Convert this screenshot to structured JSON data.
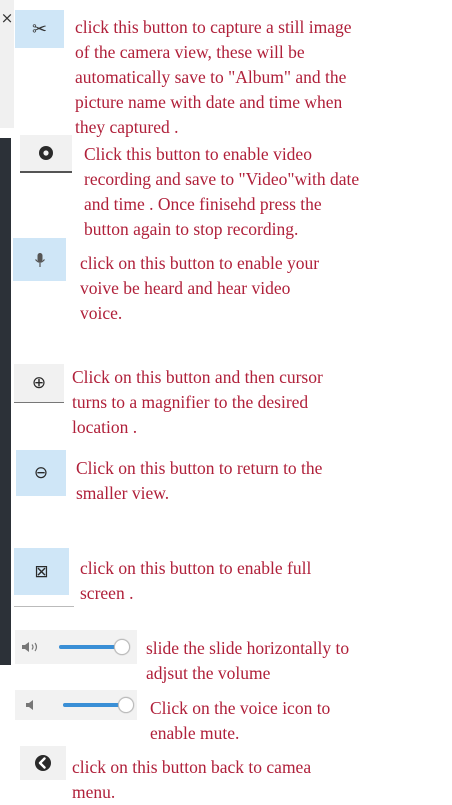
{
  "close_glyph": "×",
  "items": [
    {
      "icon": "scissors-icon",
      "glyph": "✂",
      "lines": [
        "click this button to capture a still image",
        "of the camera view, these will be",
        "automatically save to \"Album\" and the",
        "picture name with date and time when",
        "they captured ."
      ]
    },
    {
      "icon": "record-icon",
      "glyph": "",
      "lines": [
        "Click this button to enable video",
        "recording and save to \"Video\"with date",
        "and time . Once finisehd press the",
        "button again to stop recording."
      ]
    },
    {
      "icon": "microphone-icon",
      "glyph": "",
      "lines": [
        "click on this button to enable your",
        "voive be heard and hear video",
        "voice."
      ]
    },
    {
      "icon": "zoom-in-icon",
      "glyph": "⊕",
      "lines": [
        "Click on this button and then cursor",
        "turns to a magnifier to the desired",
        "location ."
      ]
    },
    {
      "icon": "zoom-out-icon",
      "glyph": "⊖",
      "lines": [
        "Click on this button to return to the",
        "smaller view."
      ]
    },
    {
      "icon": "fullscreen-icon",
      "glyph": "⊠",
      "lines": [
        "click on this button to enable full",
        "screen ."
      ]
    },
    {
      "icon": "volume-icon",
      "glyph": "",
      "lines": [
        "slide the slide horizontally to",
        "adjsut the volume"
      ]
    },
    {
      "icon": "mute-icon",
      "glyph": "",
      "lines": [
        "Click on the voice icon  to",
        "enable mute."
      ]
    },
    {
      "icon": "back-icon",
      "glyph": "",
      "lines": [
        "click on this button back to camea",
        "menu."
      ]
    }
  ],
  "volume_slider_level": 0.9,
  "mute_slider_level": 0.9,
  "colors": {
    "text": "#b0203a",
    "button": "#cfe6f7",
    "sidebar": "#2c3138"
  }
}
